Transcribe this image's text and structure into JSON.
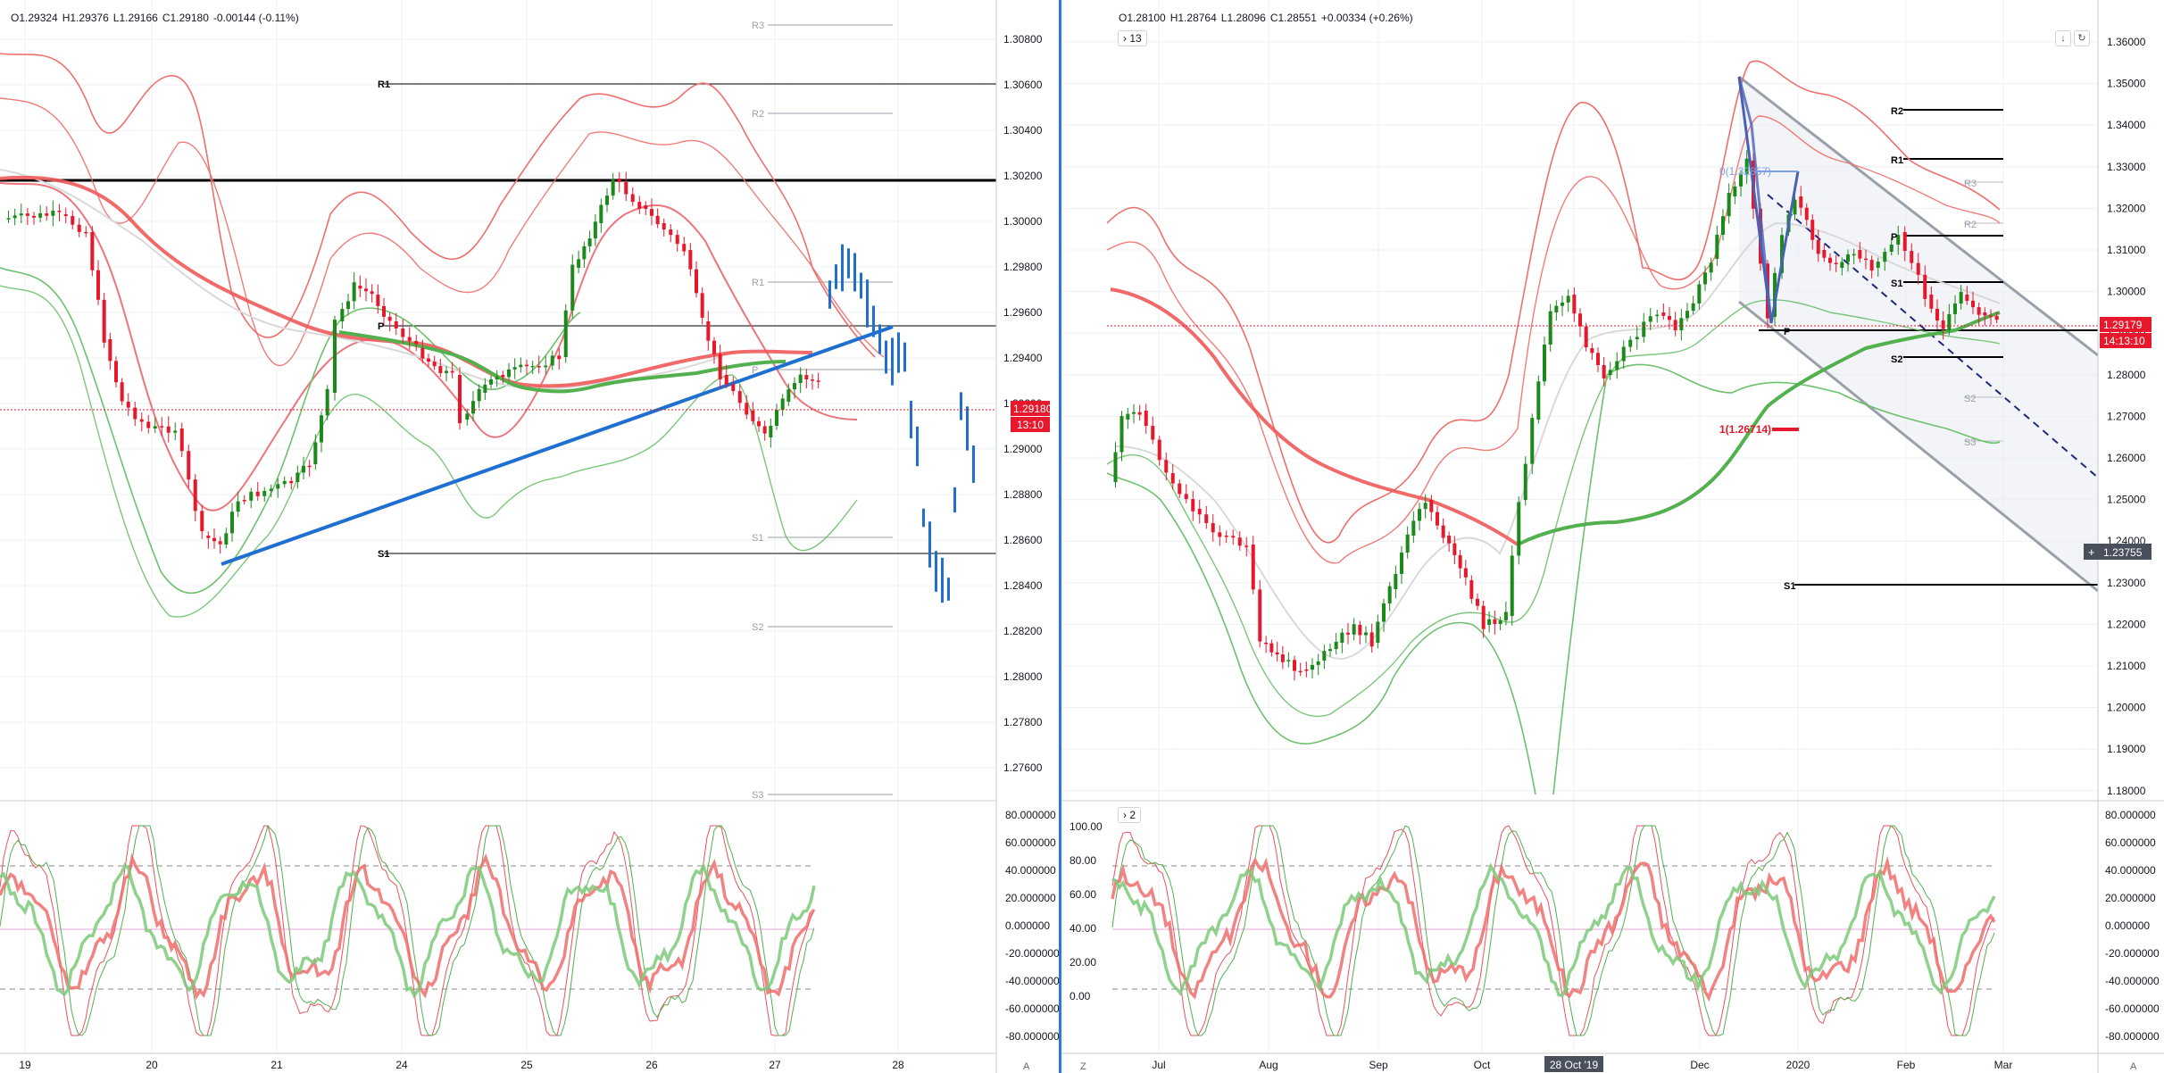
{
  "left_chart": {
    "ohlc": {
      "open": "O1.29324",
      "high": "H1.29376",
      "low": "L1.29166",
      "close": "C1.29180",
      "change": "-0.00144 (-0.11%)"
    },
    "price_ticks": [
      "1.30800",
      "1.30600",
      "1.30400",
      "1.30200",
      "1.30000",
      "1.29800",
      "1.29600",
      "1.29400",
      "1.29200",
      "1.29000",
      "1.28800",
      "1.28600",
      "1.28400",
      "1.28200",
      "1.28000",
      "1.27800",
      "1.27600"
    ],
    "current_price": "1.29180",
    "countdown": "13:10",
    "osc_ticks": [
      "80.000000",
      "60.000000",
      "40.000000",
      "20.000000",
      "0.000000",
      "-20.000000",
      "-40.000000",
      "-60.000000",
      "-80.000000"
    ],
    "date_ticks": [
      "19",
      "20",
      "21",
      "24",
      "25",
      "26",
      "27",
      "28"
    ],
    "pivot_labels": [
      "R3",
      "R2",
      "R1",
      "P",
      "S1",
      "S2",
      "S3",
      "R1",
      "P",
      "S1"
    ],
    "corner_badge": "A"
  },
  "right_chart": {
    "ohlc": {
      "open": "O1.28100",
      "high": "H1.28764",
      "low": "L1.28096",
      "close": "C1.28551",
      "change": "+0.00334 (+0.26%)"
    },
    "indicator_chip": "13",
    "osc_chip": "2",
    "price_ticks": [
      "1.36000",
      "1.35000",
      "1.34000",
      "1.33000",
      "1.32000",
      "1.31000",
      "1.30000",
      "1.29000",
      "1.28000",
      "1.27000",
      "1.26000",
      "1.25000",
      "1.24000",
      "1.23000",
      "1.22000",
      "1.21000",
      "1.20000",
      "1.19000",
      "1.18000"
    ],
    "current_price": "1.29179",
    "countdown": "14:13:10",
    "crosshair_price": "1.23755",
    "crosshair_marker": "+",
    "osc_left_ticks": [
      "100.00",
      "80.00",
      "60.00",
      "40.00",
      "20.00",
      "0.00"
    ],
    "osc_right_ticks": [
      "80.000000",
      "60.000000",
      "40.000000",
      "20.000000",
      "0.000000",
      "-20.000000",
      "-40.000000",
      "-60.000000",
      "-80.000000"
    ],
    "date_ticks": [
      "Jul",
      "Aug",
      "Sep",
      "Oct",
      "28 Oct '19",
      "Dec",
      "2020",
      "Feb",
      "Mar"
    ],
    "pivot_labels": [
      "R2",
      "R1",
      "R3",
      "R2",
      "P",
      "S1",
      "S2",
      "S2",
      "S3",
      "P",
      "S1"
    ],
    "fib_label_top": "0(1.32857)",
    "fib_label_bottom": "1(1.26714)",
    "corner_badges": [
      "Z",
      "A"
    ],
    "header_icons": [
      "arrow-down-icon",
      "refresh-icon"
    ]
  },
  "colors": {
    "bull": "#1b8a1b",
    "bear": "#e8182c",
    "blue": "#1e6fd0",
    "bb_red": "#ef6f6c",
    "bb_green": "#6cc16c",
    "grid": "#eef0f4",
    "axis_text": "#131722",
    "price_tag": "#e8182c",
    "dark_tag": "#4a4f5c"
  }
}
